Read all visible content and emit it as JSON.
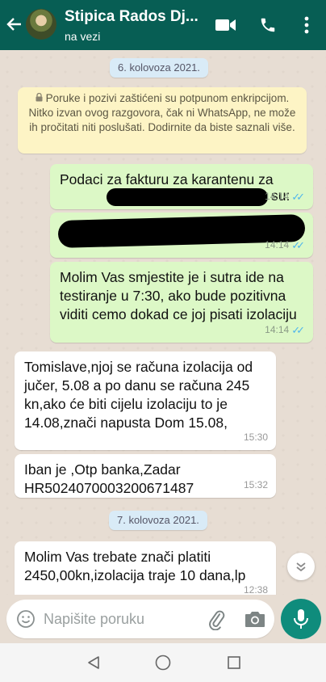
{
  "header": {
    "back_icon": "arrow-left-icon",
    "contact_name": "Stipica Rados Dj...",
    "status": "na vezi",
    "icons": [
      "video-call-icon",
      "phone-icon",
      "more-vert-icon"
    ]
  },
  "chat": {
    "date_1": "6. kolovoza 2021.",
    "encryption_notice": "Poruke i pozivi zaštićeni su potpunom enkripcijom. Nitko izvan ovog razgovora, čak ni WhatsApp, ne može ih pročitati niti poslušati. Dodirnite da biste saznali više.",
    "messages": [
      {
        "direction": "out",
        "text": "Podaci za fakturu za karantenu za",
        "text_tail": "su:",
        "time": "14:14",
        "status": "read"
      },
      {
        "direction": "out",
        "text": "",
        "time": "14:14",
        "status": "read"
      },
      {
        "direction": "out",
        "text": "Molim Vas smjestite je i sutra ide na testiranje u 7:30, ako bude pozitivna viditi cemo dokad ce joj pisati izolaciju",
        "time": "14:14",
        "status": "read"
      },
      {
        "direction": "in",
        "text": "Tomislave,njoj se računa izolacija od jučer, 5.08 a po danu se računa 245 kn,ako će biti cijelu izolaciju to je 14.08,znači napusta Dom 15.08,",
        "time": "15:30"
      },
      {
        "direction": "in",
        "text": "Iban je ,Otp banka,Zadar HR5024070003200671487",
        "time": "15:32"
      }
    ],
    "date_2": "7. kolovoza 2021.",
    "last_message": {
      "direction": "in",
      "text": "Molim Vas trebate znači platiti 2450,00kn,izolacija traje 10 dana,lp",
      "time": "12:38"
    }
  },
  "composer": {
    "placeholder": "Napišite poruku",
    "icons": [
      "emoji-icon",
      "attach-icon",
      "camera-icon",
      "mic-icon"
    ]
  },
  "system_nav": [
    "back-triangle-icon",
    "home-circle-icon",
    "recents-square-icon"
  ],
  "colors": {
    "header": "#075e54",
    "outgoing_bubble": "#dcf8c6",
    "incoming_bubble": "#ffffff",
    "read_ticks": "#4fb6ec",
    "mic_button": "#0f8c7c",
    "notice_bg": "#fdf4c5"
  }
}
